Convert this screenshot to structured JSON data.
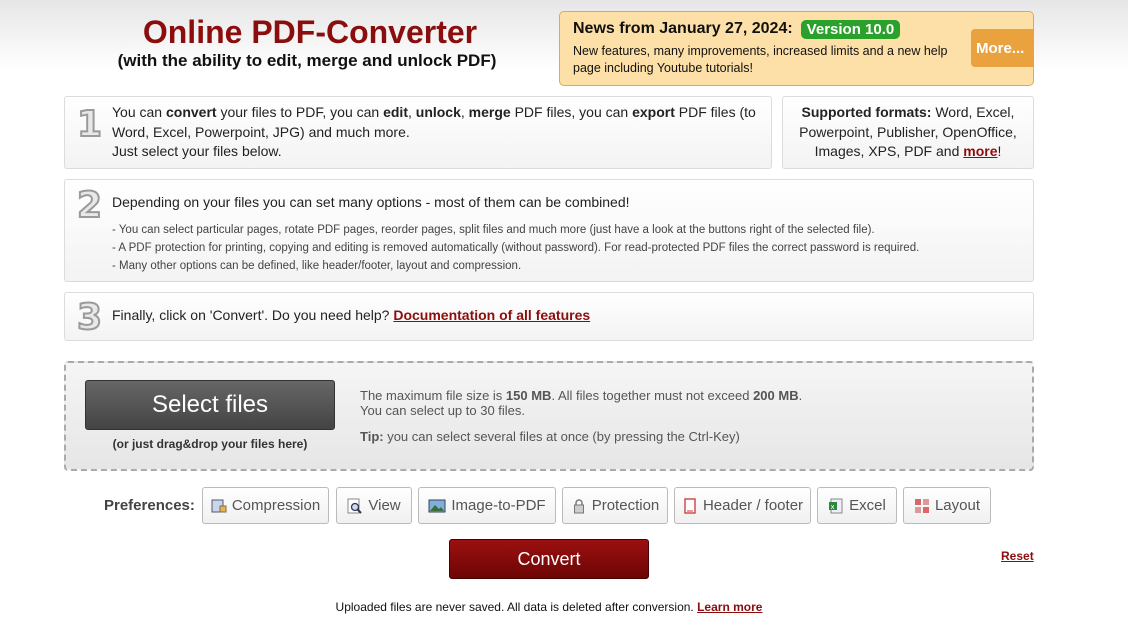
{
  "header": {
    "title": "Online PDF-Converter",
    "subtitle": "(with the ability to edit, merge and unlock PDF)"
  },
  "news": {
    "title": "News from January 27, 2024:",
    "badge": "Version 10.0",
    "text": "New features, many improvements, increased limits and a new help page including Youtube tutorials!",
    "more_label": "More..."
  },
  "step1": {
    "number": "1",
    "parts": [
      "You can ",
      "convert",
      " your files to PDF, you can ",
      "edit",
      ", ",
      "unlock",
      ", ",
      "merge",
      " PDF files, you can ",
      "export",
      " PDF files (to Word, Excel, Powerpoint, JPG) and much more."
    ],
    "line2": "Just select your files below."
  },
  "formats": {
    "label": "Supported formats:",
    "text": " Word, Excel, Powerpoint, Publisher, OpenOffice, Images, XPS, PDF and ",
    "more_link": "more",
    "end": "!"
  },
  "step2": {
    "number": "2",
    "heading": "Depending on your files you can set many options - most of them can be combined!",
    "bullets": [
      "- You can select particular pages, rotate PDF pages, reorder pages, split files and much more (just have a look at the buttons right of the selected file).",
      "- A PDF protection for printing, copying and editing is removed automatically (without password). For read-protected PDF files the correct password is required.",
      "- Many other options can be defined, like header/footer, layout and compression."
    ]
  },
  "step3": {
    "number": "3",
    "text": "Finally, click on 'Convert'. Do you need help? ",
    "doc_link": "Documentation of all features"
  },
  "upload": {
    "select_label": "Select files",
    "drag_hint": "(or just drag&drop your files here)",
    "limit_pre": "The maximum file size is ",
    "limit_max": "150 MB",
    "limit_mid": ". All files together must not exceed ",
    "limit_total": "200 MB",
    "limit_end": ".",
    "count_text": "You can select up to 30 files.",
    "tip_label": "Tip:",
    "tip_text": " you can select several files at once (by pressing the Ctrl-Key)"
  },
  "preferences": {
    "label": "Preferences:",
    "items": [
      {
        "label": "Compression",
        "icon": "compression-icon"
      },
      {
        "label": "View",
        "icon": "magnifier-icon"
      },
      {
        "label": "Image-to-PDF",
        "icon": "image-icon"
      },
      {
        "label": "Protection",
        "icon": "lock-icon"
      },
      {
        "label": "Header / footer",
        "icon": "page-icon"
      },
      {
        "label": "Excel",
        "icon": "excel-icon"
      },
      {
        "label": "Layout",
        "icon": "layout-icon"
      }
    ]
  },
  "actions": {
    "convert_label": "Convert",
    "reset_label": "Reset"
  },
  "footer": {
    "text": "Uploaded files are never saved. All data is deleted after conversion. ",
    "learn_more": "Learn more"
  },
  "colors": {
    "brand_red": "#8b0e0e",
    "news_bg": "#fde0a8",
    "badge_green": "#2aa12a",
    "more_orange": "#eaa23e"
  }
}
